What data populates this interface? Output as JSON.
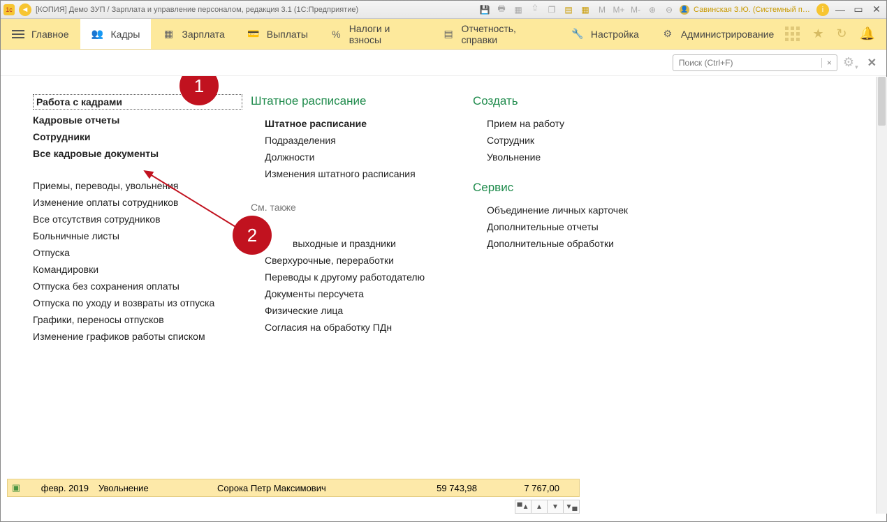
{
  "titlebar": {
    "title": "[КОПИЯ] Демо ЗУП / Зарплата и управление персоналом, редакция 3.1  (1С:Предприятие)",
    "m": "M",
    "mplus": "M+",
    "mminus": "M-",
    "user": "Савинская З.Ю. (Системный прог…"
  },
  "nav": {
    "items": [
      {
        "label": "Главное"
      },
      {
        "label": "Кадры"
      },
      {
        "label": "Зарплата"
      },
      {
        "label": "Выплаты"
      },
      {
        "label": "Налоги и взносы"
      },
      {
        "label": "Отчетность, справки"
      },
      {
        "label": "Настройка"
      },
      {
        "label": "Администрирование"
      }
    ]
  },
  "search": {
    "placeholder": "Поиск (Ctrl+F)"
  },
  "callouts": {
    "one": "1",
    "two": "2"
  },
  "col1": {
    "a1": "Работа с кадрами",
    "a2": "Кадровые отчеты",
    "a3": "Сотрудники",
    "a4": "Все кадровые документы",
    "b1": "Приемы, переводы, увольнения",
    "b2": "Изменение оплаты сотрудников",
    "b3": "Все отсутствия сотрудников",
    "b4": "Больничные листы",
    "b5": "Отпуска",
    "b6": "Командировки",
    "b7": "Отпуска без сохранения оплаты",
    "b8": "Отпуска по уходу и возвраты из отпуска",
    "b9": "Графики, переносы отпусков",
    "b10": "Изменение графиков работы списком"
  },
  "col2": {
    "hdr": "Штатное расписание",
    "s1": "Штатное расписание",
    "s2": "Подразделения",
    "s3": "Должности",
    "s4": "Изменения штатного расписания",
    "see": "См. также",
    "t2": "выходные и праздники",
    "t3": "Сверхурочные, переработки",
    "t4": "Переводы к другому работодателю",
    "t5": "Документы персучета",
    "t6": "Физические лица",
    "t7": "Согласия на обработку ПДн"
  },
  "col3": {
    "create": "Создать",
    "c1": "Прием на работу",
    "c2": "Сотрудник",
    "c3": "Увольнение",
    "service": "Сервис",
    "v1": "Объединение личных карточек",
    "v2": "Дополнительные отчеты",
    "v3": "Дополнительные обработки"
  },
  "row": {
    "date": "февр. 2019",
    "type": "Увольнение",
    "name": "Сорока Петр Максимович",
    "sum1": "59 743,98",
    "sum2": "7 767,00"
  }
}
